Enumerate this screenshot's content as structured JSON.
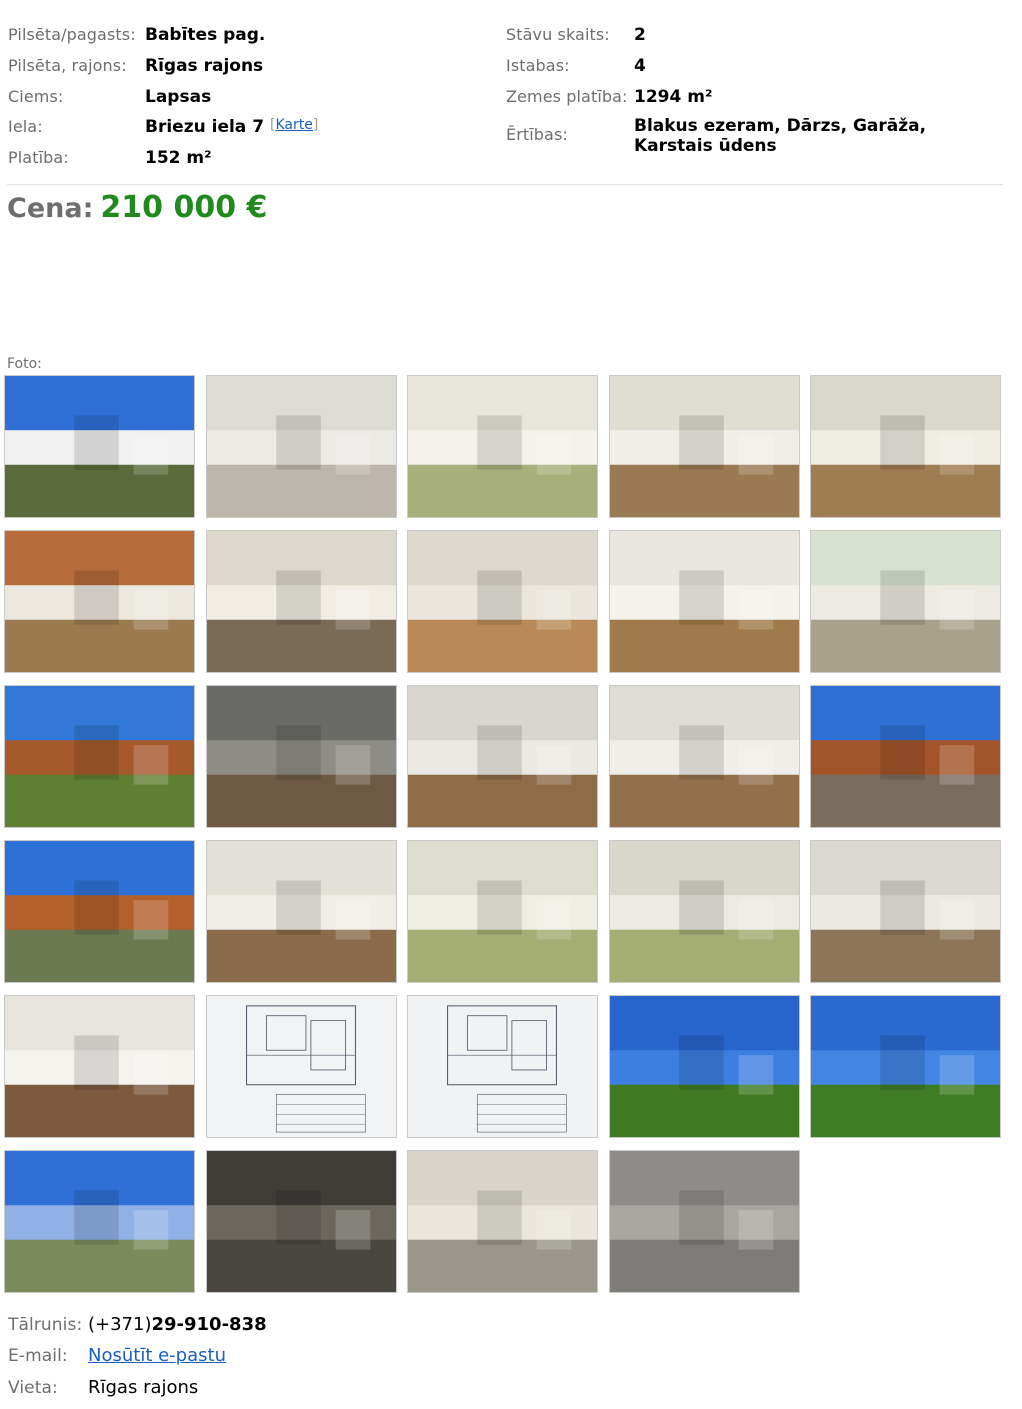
{
  "details": {
    "left": [
      {
        "label": "Pilsēta/pagasts:",
        "value": "Babītes pag."
      },
      {
        "label": "Pilsēta, rajons:",
        "value": "Rīgas rajons"
      },
      {
        "label": "Ciems:",
        "value": "Lapsas"
      },
      {
        "label": "Iela:",
        "value": "Briezu iela 7",
        "map_link": "Karte"
      },
      {
        "label": "Platība:",
        "value": "152 m²"
      }
    ],
    "right": [
      {
        "label": "Stāvu skaits:",
        "value": "2"
      },
      {
        "label": "Istabas:",
        "value": "4"
      },
      {
        "label": "Zemes platība:",
        "value": "1294 m²"
      },
      {
        "label": "Ērtības:",
        "value_line1": "Blakus ezeram, Dārzs, Garāža,",
        "value_line2": "Karstais ūdens"
      }
    ]
  },
  "price": {
    "label": "Cena:",
    "value": "210 000 €",
    "color": "#218a1f"
  },
  "photos": {
    "label": "Foto:",
    "items": [
      {
        "scene": "house-exterior",
        "sky": "#2f6fd6",
        "top": "#f1f1f1",
        "floor": "#5a6a3a"
      },
      {
        "scene": "hallway-doors",
        "sky": "#dcdcd4",
        "top": "#eceae4",
        "floor": "#bcb7aa"
      },
      {
        "scene": "bathroom-sink",
        "sky": "#e8e6dc",
        "top": "#f4f2ea",
        "floor": "#a7b07a"
      },
      {
        "scene": "living-room",
        "sky": "#e0ddd2",
        "top": "#f0eee8",
        "floor": "#9a7a52"
      },
      {
        "scene": "living-sofa",
        "sky": "#dad7cd",
        "top": "#efece4",
        "floor": "#a07c52"
      },
      {
        "scene": "laundry-door",
        "sky": "#b66b3a",
        "top": "#ece8e0",
        "floor": "#9b7a50"
      },
      {
        "scene": "kitchen",
        "sky": "#ddd8cc",
        "top": "#f1ede4",
        "floor": "#7b6a55"
      },
      {
        "scene": "staircase",
        "sky": "#ded9cf",
        "top": "#eae6de",
        "floor": "#b98a58"
      },
      {
        "scene": "upper-hall",
        "sky": "#e8e6de",
        "top": "#f4f2ec",
        "floor": "#a07a4a"
      },
      {
        "scene": "room-door",
        "sky": "#d9e2d0",
        "top": "#eceae2",
        "floor": "#a9a28a"
      },
      {
        "scene": "balcony-view",
        "sky": "#3178d8",
        "top": "#a65a2c",
        "floor": "#5f7f32"
      },
      {
        "scene": "attic-room",
        "sky": "#6a6a66",
        "top": "#8e8c86",
        "floor": "#6e5a44"
      },
      {
        "scene": "bedroom",
        "sky": "#d8d6cf",
        "top": "#ebe9e2",
        "floor": "#8e6c48"
      },
      {
        "scene": "bedroom-wardrobe",
        "sky": "#dedcd4",
        "top": "#f0eee8",
        "floor": "#93704c"
      },
      {
        "scene": "balcony-door",
        "sky": "#2d6fd3",
        "top": "#a3542a",
        "floor": "#7a6d5e"
      },
      {
        "scene": "balcony-roof",
        "sky": "#2e71d6",
        "top": "#b4602c",
        "floor": "#6b7a50"
      },
      {
        "scene": "wardrobe-hall",
        "sky": "#e2e0d8",
        "top": "#f0eee6",
        "floor": "#8a6c4c"
      },
      {
        "scene": "bathtub",
        "sky": "#dcdccf",
        "top": "#eeeee4",
        "floor": "#a3ad74"
      },
      {
        "scene": "bathroom-shelf",
        "sky": "#d9d6cc",
        "top": "#eceae2",
        "floor": "#a3ad74"
      },
      {
        "scene": "attic-bedroom",
        "sky": "#dad8d0",
        "top": "#ebe9e2",
        "floor": "#8b7458"
      },
      {
        "scene": "white-wardrobe",
        "sky": "#e6e4dd",
        "top": "#f4f3ee",
        "floor": "#7c5a3e"
      },
      {
        "scene": "floor-plan-1",
        "sky": "#e7e9ec",
        "top": "#f2f3f5",
        "floor": "#dcdfe4"
      },
      {
        "scene": "floor-plan-2",
        "sky": "#e4e6ea",
        "top": "#f1f2f4",
        "floor": "#d9dce1"
      },
      {
        "scene": "lawn-house",
        "sky": "#2764cc",
        "top": "#3d7fe0",
        "floor": "#3f7a22"
      },
      {
        "scene": "lawn-trees",
        "sky": "#2a69d0",
        "top": "#4285e2",
        "floor": "#3e7d24"
      },
      {
        "scene": "driveway-car",
        "sky": "#2f6fd6",
        "top": "#8fb1e6",
        "floor": "#7a8a5a"
      },
      {
        "scene": "garage",
        "sky": "#3f3c38",
        "top": "#6b675f",
        "floor": "#4a4740"
      },
      {
        "scene": "boiler-room",
        "sky": "#d8d4ca",
        "top": "#eae6dc",
        "floor": "#9a968c"
      },
      {
        "scene": "wall-charger",
        "sky": "#8e8c88",
        "top": "#a8a6a0",
        "floor": "#7e7c78"
      }
    ]
  },
  "contact": {
    "phone_label": "Tālrunis:",
    "phone_prefix": "(+371)",
    "phone_number": "29-910-838",
    "email_label": "E-mail:",
    "email_link": "Nosūtīt e-pastu",
    "place_label": "Vieta:",
    "place_value": "Rīgas rajons"
  }
}
